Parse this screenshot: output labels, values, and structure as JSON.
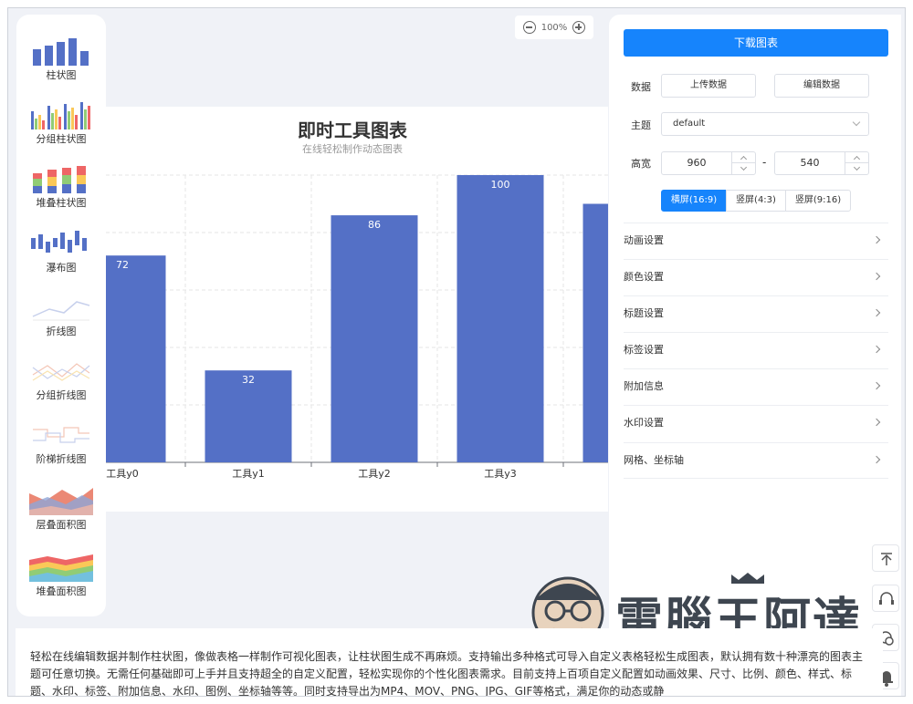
{
  "sidebar": {
    "items": [
      {
        "label": "柱状图",
        "icon": "bar-chart-icon"
      },
      {
        "label": "分组柱状图",
        "icon": "grouped-bar-chart-icon"
      },
      {
        "label": "堆叠柱状图",
        "icon": "stacked-bar-chart-icon"
      },
      {
        "label": "瀑布图",
        "icon": "waterfall-chart-icon"
      },
      {
        "label": "折线图",
        "icon": "line-chart-icon"
      },
      {
        "label": "分组折线图",
        "icon": "grouped-line-chart-icon"
      },
      {
        "label": "阶梯折线图",
        "icon": "step-line-chart-icon"
      },
      {
        "label": "层叠面积图",
        "icon": "layered-area-chart-icon"
      },
      {
        "label": "堆叠面积图",
        "icon": "stacked-area-chart-icon"
      }
    ]
  },
  "zoom": {
    "level": "100%"
  },
  "chart_data": {
    "type": "bar",
    "title": "即时工具图表",
    "subtitle": "在线轻松制作动态图表",
    "categories": [
      "工具y0",
      "工具y1",
      "工具y2",
      "工具y3",
      ""
    ],
    "values": [
      72,
      32,
      86,
      100,
      90
    ],
    "data_labels": [
      "72",
      "32",
      "86",
      "100",
      ""
    ],
    "ylim": [
      0,
      100
    ],
    "grid": true,
    "bar_color": "#5470c6"
  },
  "panel": {
    "download_label": "下载图表",
    "data_label": "数据",
    "upload_label": "上传数据",
    "edit_label": "编辑数据",
    "theme_label": "主题",
    "theme_value": "default",
    "size_label": "高宽",
    "width_value": "960",
    "height_value": "540",
    "size_separator": "-",
    "ratios": [
      "横屏(16:9)",
      "竖屏(4:3)",
      "竖屏(9:16)"
    ],
    "active_ratio": "横屏(16:9)",
    "settings": [
      "动画设置",
      "颜色设置",
      "标题设置",
      "标签设置",
      "附加信息",
      "水印设置",
      "网格、坐标轴"
    ]
  },
  "watermark": {
    "text": "電腦王阿達"
  },
  "description": "轻松在线编辑数据并制作柱状图，像做表格一样制作可视化图表，让柱状图生成不再麻烦。支持输出多种格式可导入自定义表格轻松生成图表，默认拥有数十种漂亮的图表主题可任意切换。无需任何基础即可上手并且支持超全的自定义配置，轻松实现你的个性化图表需求。目前支持上百项自定义配置如动画效果、尺寸、比例、颜色、样式、标题、水印、标签、附加信息、水印、图例、坐标轴等等。同时支持导出为MP4、MOV、PNG、JPG、GIF等格式，满足你的动态或静",
  "colors": {
    "accent": "#1684fc",
    "bar": "#5470c6",
    "background": "#f0f2f7"
  }
}
